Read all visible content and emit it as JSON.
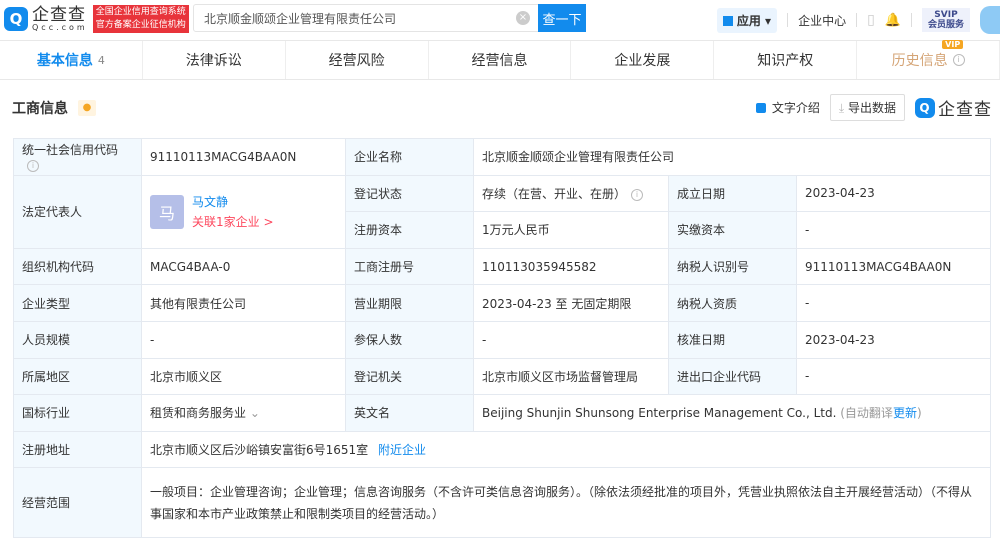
{
  "header": {
    "logo_text": "企查查",
    "logo_domain": "Qcc.com",
    "badge_line1": "全国企业信用查询系统",
    "badge_line2": "官方备案企业征信机构",
    "search_value": "北京顺金顺颂企业管理有限责任公司",
    "search_button": "查一下",
    "apps": "应用",
    "enterprise_center": "企业中心",
    "svip_line1": "SVIP",
    "svip_line2": "会员服务"
  },
  "tabs": [
    {
      "label": "基本信息",
      "count": "4"
    },
    {
      "label": "法律诉讼"
    },
    {
      "label": "经营风险"
    },
    {
      "label": "经营信息"
    },
    {
      "label": "企业发展"
    },
    {
      "label": "知识产权"
    },
    {
      "label": "历史信息",
      "badge": "VIP"
    }
  ],
  "section": {
    "title": "工商信息",
    "text_intro": "文字介绍",
    "export": "导出数据",
    "brand": "企查查"
  },
  "info": {
    "credit_code_label": "统一社会信用代码",
    "credit_code": "91110113MACG4BAA0N",
    "name_label": "企业名称",
    "name": "北京顺金顺颂企业管理有限责任公司",
    "legal_rep_label": "法定代表人",
    "legal_rep_avatar": "马",
    "legal_rep": "马文静",
    "legal_rep_link": "关联1家企业 >",
    "status_label": "登记状态",
    "status": "存续（在营、开业、在册）",
    "founded_label": "成立日期",
    "founded": "2023-04-23",
    "capital_label": "注册资本",
    "capital": "1万元人民币",
    "paid_label": "实缴资本",
    "paid": "-",
    "org_code_label": "组织机构代码",
    "org_code": "MACG4BAA-0",
    "reg_no_label": "工商注册号",
    "reg_no": "110113035945582",
    "tax_id_label": "纳税人识别号",
    "tax_id": "91110113MACG4BAA0N",
    "type_label": "企业类型",
    "type": "其他有限责任公司",
    "term_label": "营业期限",
    "term": "2023-04-23 至 无固定期限",
    "tax_qual_label": "纳税人资质",
    "tax_qual": "-",
    "staff_label": "人员规模",
    "staff": "-",
    "insured_label": "参保人数",
    "insured": "-",
    "approved_label": "核准日期",
    "approved": "2023-04-23",
    "region_label": "所属地区",
    "region": "北京市顺义区",
    "authority_label": "登记机关",
    "authority": "北京市顺义区市场监督管理局",
    "import_label": "进出口企业代码",
    "import": "-",
    "industry_label": "国标行业",
    "industry": "租赁和商务服务业",
    "en_name_label": "英文名",
    "en_name": "Beijing Shunjin Shunsong Enterprise Management Co., Ltd.",
    "en_auto": "(自动翻译",
    "en_update": "更新",
    "en_close": ")",
    "address_label": "注册地址",
    "address": "北京市顺义区后沙峪镇安富街6号1651室",
    "nearby": "附近企业",
    "scope_label": "经营范围",
    "scope": "一般项目：企业管理咨询；企业管理；信息咨询服务（不含许可类信息咨询服务）。（除依法须经批准的项目外，凭营业执照依法自主开展经营活动）（不得从事国家和本市产业政策禁止和限制类项目的经营活动。）"
  }
}
